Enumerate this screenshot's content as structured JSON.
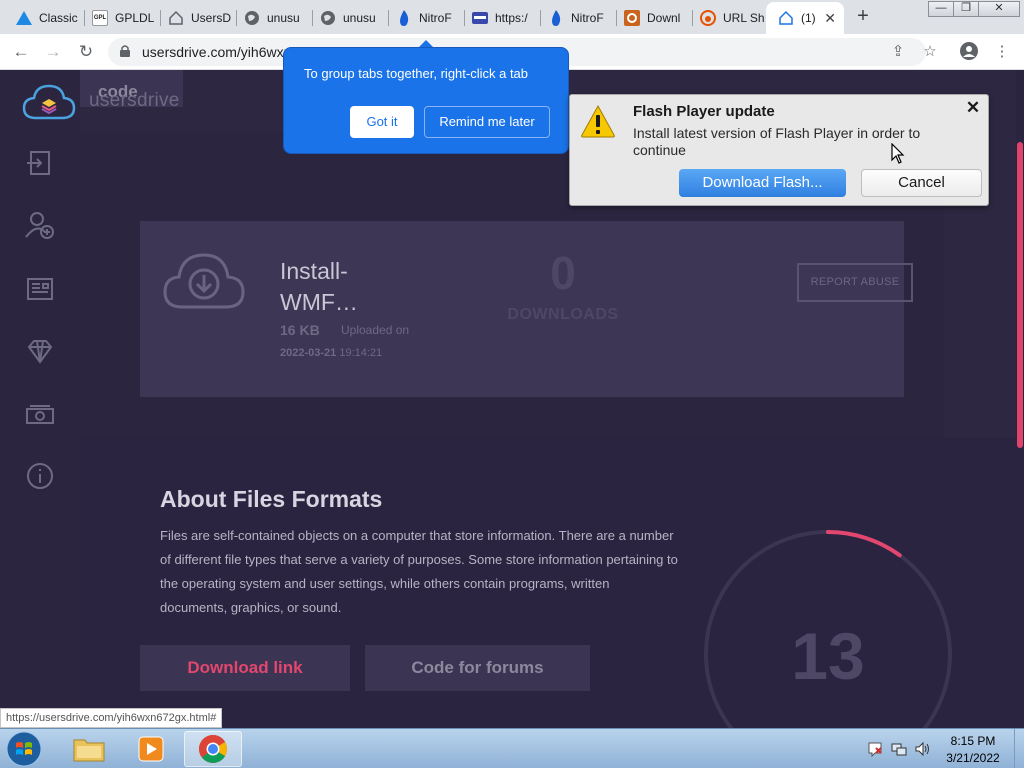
{
  "browser": {
    "tabs": [
      {
        "title": "Classic",
        "icon": "triangle-icon"
      },
      {
        "title": "GPLDL",
        "icon": "gpldl-icon",
        "icon_text": "GPL"
      },
      {
        "title": "UsersD",
        "icon": "house-icon"
      },
      {
        "title": "unusu",
        "icon": "globe-icon"
      },
      {
        "title": "unusu",
        "icon": "globe-icon"
      },
      {
        "title": "NitroF",
        "icon": "flame-icon"
      },
      {
        "title": "https:/",
        "icon": "card-icon"
      },
      {
        "title": "NitroF",
        "icon": "flame-icon"
      },
      {
        "title": "Downl",
        "icon": "download-site-icon"
      },
      {
        "title": "URL Sh",
        "icon": "url-shortener-icon"
      },
      {
        "title": "(1)",
        "icon": "house-icon",
        "active": true
      }
    ],
    "url": "usersdrive.com/yih6wxn672gx.html",
    "status_url": "https://usersdrive.com/yih6wxn672gx.html#"
  },
  "tab_group_tip": {
    "text": "To group tabs together, right-click a tab",
    "got_it": "Got it",
    "remind_later": "Remind me later"
  },
  "flash_dialog": {
    "title": "Flash Player update",
    "message": "Install latest version of Flash Player in order to continue",
    "download_label": "Download Flash...",
    "cancel_label": "Cancel"
  },
  "site": {
    "brand": "usersdrive",
    "sidebar_icons": [
      "login-icon",
      "add-user-icon",
      "news-icon",
      "diamond-icon",
      "money-icon",
      "info-icon"
    ],
    "file": {
      "name": "Install-WMF…",
      "size": "16 KB",
      "uploaded_label": "Uploaded on",
      "upload_date": "2022-03-21",
      "upload_time": "19:14:21",
      "downloads": "0",
      "downloads_label": "DOWNLOADS",
      "report_label": "REPORT ABUSE"
    },
    "about": {
      "title": "About Files Formats",
      "text": "Files are self-contained objects on a computer that store information. There are a number of different file types that serve a variety of purposes. Some store information pertaining to the operating system and user settings, while others contain programs, written documents, graphics, or sound."
    },
    "countdown": {
      "value": "13",
      "progress": 0.1
    },
    "buttons": {
      "download_link": "Download link",
      "code_forums": "Code for forums",
      "code_html": "code"
    }
  },
  "taskbar": {
    "time": "8:15 PM",
    "date": "3/21/2022"
  },
  "colors": {
    "accent": "#e3466f",
    "page_bg": "#2d2741",
    "chrome_blue": "#1a73e8"
  }
}
